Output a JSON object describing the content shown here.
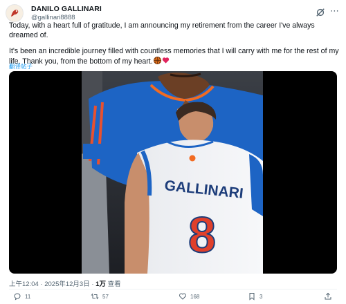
{
  "author": {
    "display_name": "DANILO GALLINARI",
    "handle": "@gallinari8888"
  },
  "tweet": {
    "paragraph_1": "Today, with a heart full of gratitude, I am announcing my retirement from the career I've always dreamed of.",
    "paragraph_2": "It's been an incredible journey filled with countless memories that I will carry with me for the rest of my life. Thank you, from the bottom of my heart.",
    "translate_label": "翻译帖子"
  },
  "media": {
    "jersey_name": "GALLINARI",
    "jersey_number": "8"
  },
  "meta": {
    "timestamp": "上午12:04 · 2025年12月3日 · ",
    "views_count": "1万",
    "views_label": " 查看"
  },
  "actions": {
    "replies": "11",
    "reposts": "57",
    "likes": "168",
    "bookmarks": "3"
  },
  "colors": {
    "link": "#1d9bf0",
    "knicks_blue": "#1d64c4",
    "knicks_orange": "#f26b21",
    "text_secondary": "#536471"
  },
  "icons": [
    "grok-icon",
    "more-icon",
    "reply-icon",
    "repost-icon",
    "like-icon",
    "bookmark-icon",
    "share-icon",
    "basketball-emoji",
    "heart-emoji"
  ]
}
